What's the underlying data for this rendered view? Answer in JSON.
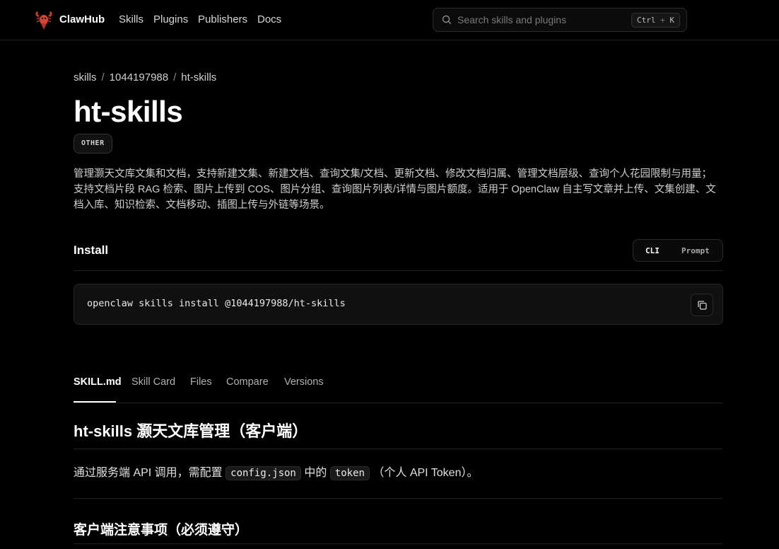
{
  "header": {
    "brand": "ClawHub",
    "nav": [
      "Skills",
      "Plugins",
      "Publishers",
      "Docs"
    ],
    "search": {
      "placeholder": "Search skills and plugins",
      "shortcut_key1": "Ctrl",
      "shortcut_plus": "+",
      "shortcut_key2": "K"
    }
  },
  "breadcrumb": {
    "items": [
      "skills",
      "1044197988",
      "ht-skills"
    ],
    "separator": "/"
  },
  "skill": {
    "title": "ht-skills",
    "category": "OTHER",
    "description": "管理灏天文库文集和文档，支持新建文集、新建文档、查询文集/文档、更新文档、修改文档归属、管理文档层级、查询个人花园限制与用量；支持文档片段 RAG 检索、图片上传到 COS、图片分组、查询图片列表/详情与图片额度。适用于 OpenClaw 自主写文章并上传、文集创建、文档入库、知识检索、文档移动、插图上传与外链等场景。"
  },
  "install": {
    "heading": "Install",
    "modes": [
      "CLI",
      "Prompt"
    ],
    "command": "openclaw skills install @1044197988/ht-skills"
  },
  "tabs": [
    "SKILL.md",
    "Skill Card",
    "Files",
    "Compare",
    "Versions"
  ],
  "content": {
    "heading": "ht-skills 灏天文库管理（客户端）",
    "para_part1": "通过服务端 API 调用，需配置",
    "para_code1": "config.json",
    "para_part2": "中的",
    "para_code2": "token",
    "para_part3": "（个人 API Token）。",
    "subheading": "客户端注意事项（必须遵守）"
  },
  "colors": {
    "background": "#000000",
    "logo": "#c0392b"
  }
}
